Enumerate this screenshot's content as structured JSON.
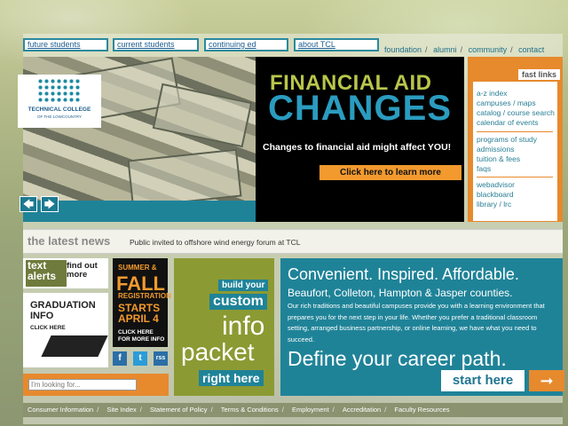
{
  "nav": {
    "tabs": [
      "future students",
      "current students",
      "continuing ed",
      "about TCL"
    ],
    "util_links": [
      "foundation",
      "alumni",
      "community",
      "contact"
    ]
  },
  "hero": {
    "logo_line1": "TECHNICAL COLLEGE",
    "logo_line2": "OF THE LOWCOUNTRY",
    "headline1": "FINANCIAL AID",
    "headline2": "CHANGES",
    "subline": "Changes to financial aid might affect YOU!",
    "cta": "Click here to learn more",
    "prev_arrow": "🡄",
    "next_arrow": "🡆"
  },
  "fast_links": {
    "title": "fast links",
    "group1": [
      "a-z index",
      "campuses / maps",
      "catalog / course search",
      "calendar of events"
    ],
    "group2": [
      "programs of study",
      "admissions",
      "tuition & fees",
      "faqs"
    ],
    "group3": [
      "webadvisor",
      "blackboard",
      "library / lrc"
    ]
  },
  "news": {
    "label": "the latest news",
    "headline": "Public invited to offshore wind energy forum at TCL"
  },
  "promos": {
    "text_alerts": "text alerts",
    "find_out_more": "find out more",
    "grad_title": "GRADUATION INFO",
    "grad_cta": "CLICK HERE",
    "summer_line1": "SUMMER &",
    "summer_line2": "FALL",
    "summer_line3": "REGISTRATION",
    "summer_line4": "STARTS APRIL 4",
    "summer_line5": "CLICK HERE FOR MORE INFO",
    "social": [
      "f",
      "t",
      "rss"
    ]
  },
  "search": {
    "placeholder": "I'm looking for..."
  },
  "info_packet": {
    "line1": "build your",
    "line2": "custom",
    "line3": "info",
    "line4": "packet",
    "line5": "right here"
  },
  "convenient": {
    "title": "Convenient. Inspired. Affordable.",
    "counties": "Beaufort, Colleton, Hampton & Jasper counties.",
    "body": "Our rich traditions and beautiful campuses provide you with a learning environment that prepares you for the next step in your life. Whether you prefer a traditional classroom setting, arranged business partnership, or online learning, we have what you need to succeed.",
    "tagline": "Define your career path.",
    "cta": "start here",
    "cta_arrow": "➞"
  },
  "footer": [
    "Consumer Information",
    "Site Index",
    "Statement of Policy",
    "Terms & Conditions",
    "Employment",
    "Accreditation",
    "Faculty Resources"
  ],
  "colors": {
    "teal": "#1f8398",
    "orange": "#e7892d",
    "olive": "#8c9a33"
  }
}
